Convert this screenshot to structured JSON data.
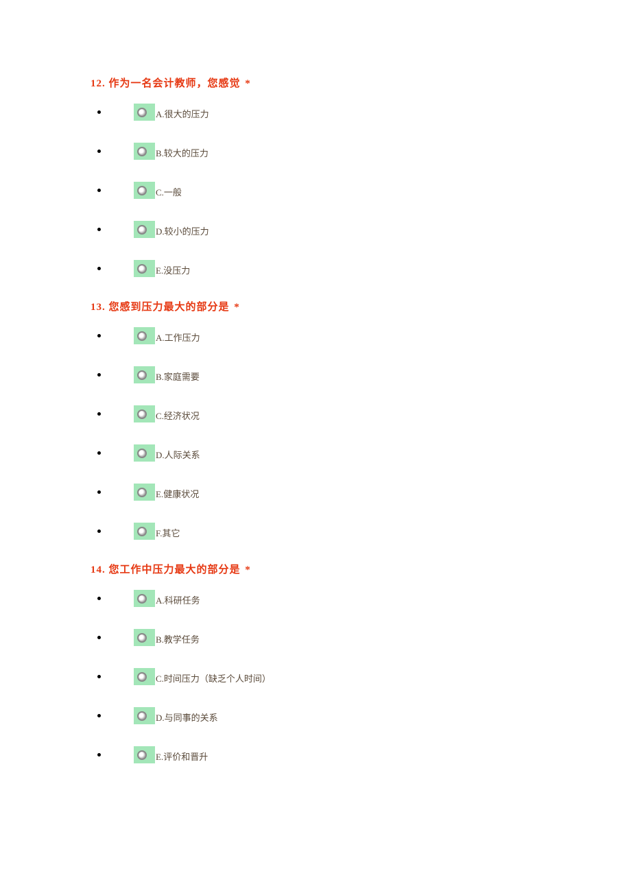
{
  "questions": [
    {
      "number": "12.",
      "title": "作为一名会计教师，您感觉",
      "required": "*",
      "options": [
        "A.很大的压力",
        "B.较大的压力",
        "C.一般",
        "D.较小的压力",
        "E.没压力"
      ]
    },
    {
      "number": "13.",
      "title": "您感到压力最大的部分是",
      "required": "*",
      "options": [
        "A.工作压力",
        "B.家庭需要",
        "C.经济状况",
        "D.人际关系",
        "E.健康状况",
        "F.其它"
      ]
    },
    {
      "number": "14.",
      "title": "您工作中压力最大的部分是",
      "required": "*",
      "options": [
        "A.科研任务",
        "B.教学任务",
        "C.时间压力（缺乏个人时间）",
        "D.与同事的关系",
        "E.评价和晋升"
      ]
    }
  ]
}
